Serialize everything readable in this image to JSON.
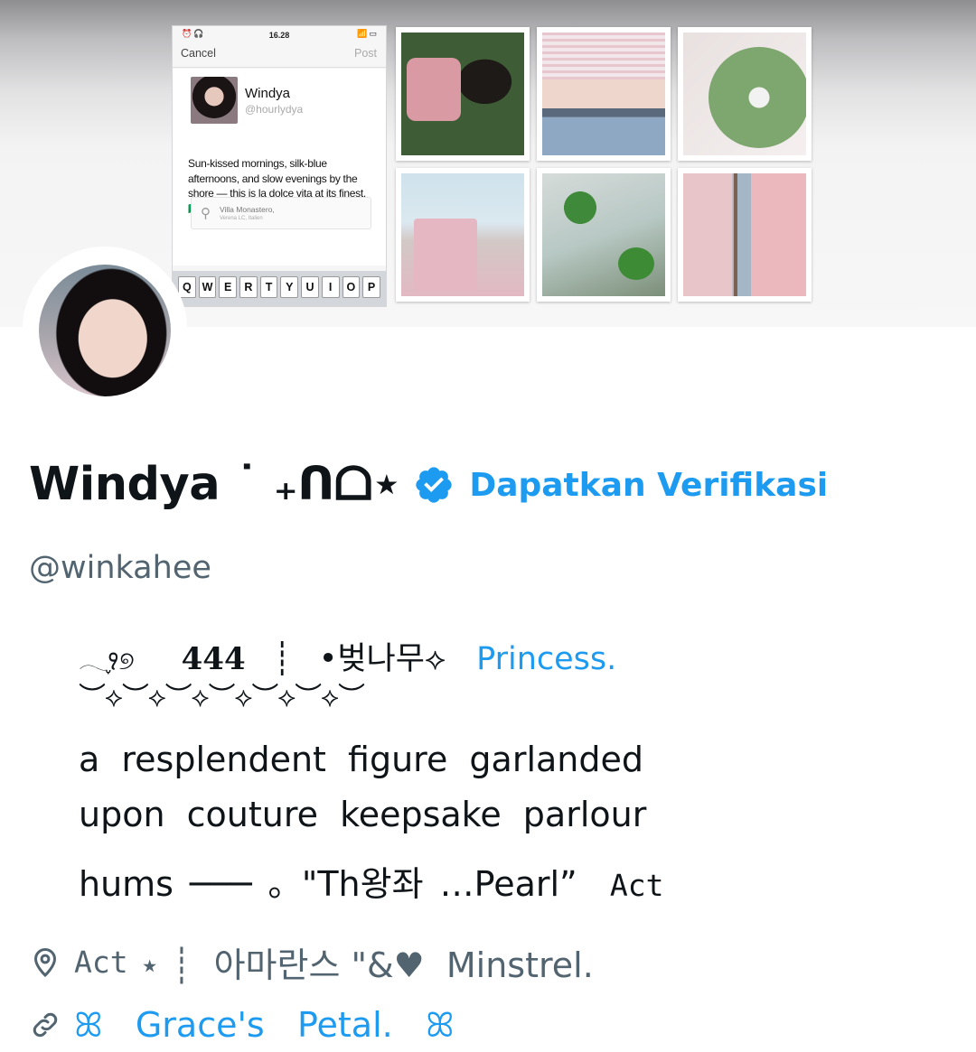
{
  "banner": {
    "phone": {
      "time": "16.28",
      "cancel_label": "Cancel",
      "post_label": "Post",
      "name": "Windya",
      "handle": "@hourlydya",
      "text": "Sun-kissed mornings, silk-blue afternoons, and slow evenings by the shore — this is la dolce vita at its finest. 🇮🇹🌊",
      "location_line1": "Villa Monastero,",
      "location_line2": "Verena LC, Italien",
      "keys": [
        "Q",
        "W",
        "E",
        "R",
        "T",
        "Y",
        "U",
        "I",
        "O",
        "P"
      ]
    }
  },
  "profile": {
    "display_name": "Windya ˙ ₊ᑎᗝ⋆",
    "verified_icon": "verified-badge-icon",
    "get_verified_label": "Dapatkan Verifikasi",
    "handle": "@winkahee"
  },
  "bio": {
    "line1_deco": "𓂃֢꣑୭",
    "line1_num": "444",
    "line1_bar": "┊",
    "line1_korean": "•벚나무⟡",
    "line1_princess": "Princess.",
    "line2": "︶⟡︶⟡︶⟡︶⟡︶⟡︶⟡︶",
    "line3": "a resplendent figure garlanded",
    "line4": "upon couture keepsake parlour",
    "line5_text": "hums ─── ｡ \"Th왕좌 …Pearl”",
    "line5_act": "Act"
  },
  "meta": {
    "location_icon": "location-pin-icon",
    "location_act": "Act",
    "location_rest": " ⋆ ┊  아마란스 \"&♥  Minstrel.",
    "link_icon": "link-icon",
    "link_text": "ꕤ   Grace's   Petal.   ꕤ"
  },
  "colors": {
    "accent": "#1d9bf0",
    "secondary_text": "#536471",
    "primary_text": "#0f1419"
  }
}
